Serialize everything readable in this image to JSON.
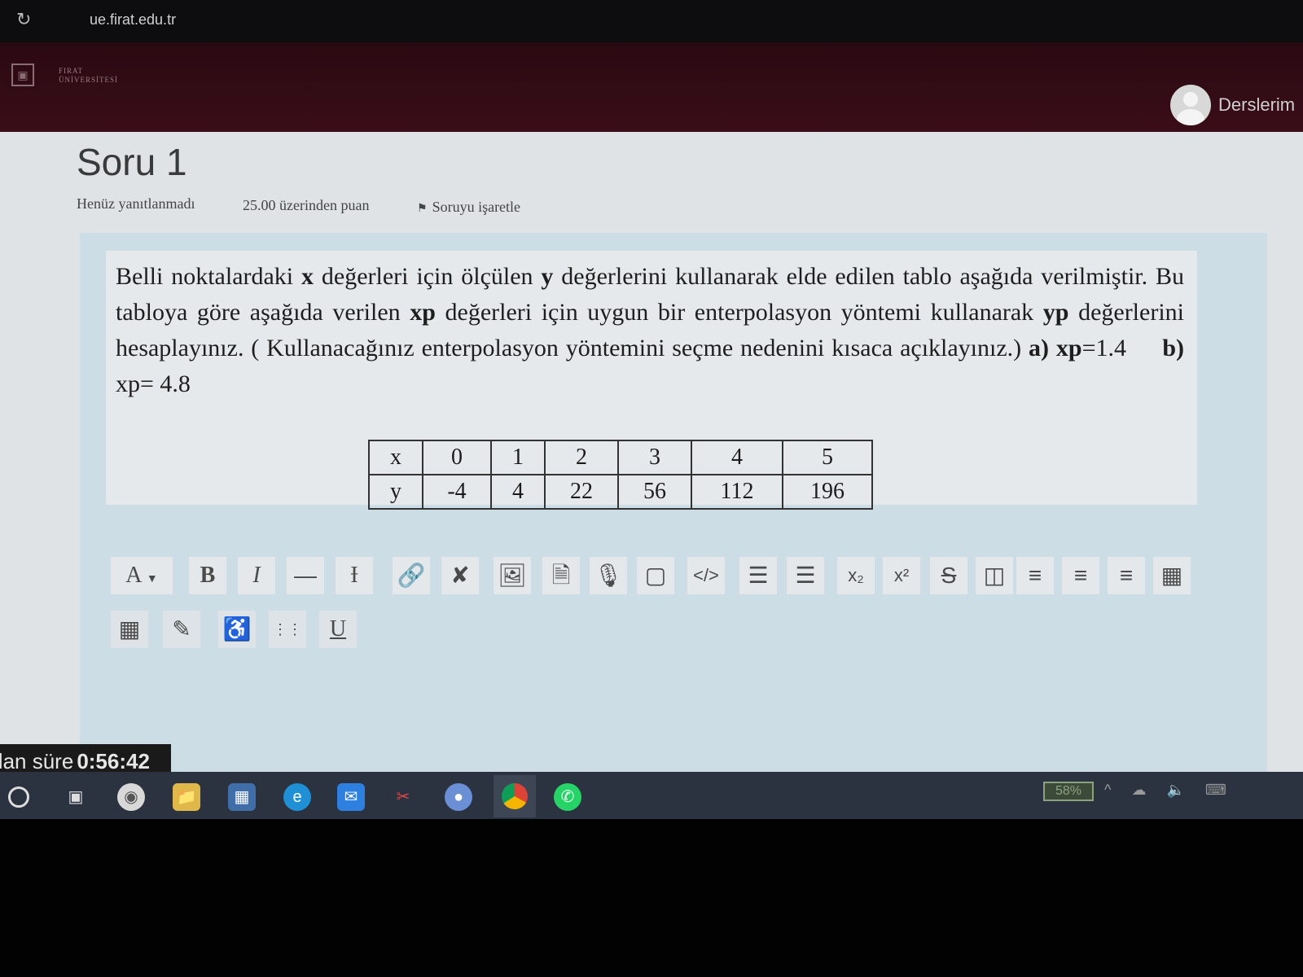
{
  "browser": {
    "url": "ue.firat.edu.tr"
  },
  "header": {
    "logo_line1": "FIRAT",
    "logo_line2": "ÜNİVERSİTESİ",
    "user_menu_label": "Derslerim"
  },
  "question": {
    "title": "Soru 1",
    "status": "Henüz yanıtlanmadı",
    "points": "25.00 üzerinden puan",
    "flag_label": "Soruyu işaretle",
    "text_part1": "Belli noktalardaki",
    "var_x": "x",
    "text_part2": "değerleri için ölçülen",
    "var_y": "y",
    "text_part3": "değerlerini kullanarak elde edilen tablo aşağıda verilmiştir. Bu tabloya göre aşağıda verilen",
    "var_xp": "xp",
    "text_part4": "değerleri için uygun bir enterpolasyon yöntemi kullanarak",
    "var_yp": "yp",
    "text_part5": "değerlerini hesaplayınız. ( Kullanacağınız enterpolasyon yöntemini seçme nedenini kısaca açıklayınız.)",
    "part_a_label": "a)",
    "part_a_var": "xp",
    "part_a_value": "=1.4",
    "part_b_label": "b)",
    "part_b_var": "xp",
    "part_b_value": "= 4.8"
  },
  "table": {
    "row_x": [
      "x",
      "0",
      "1",
      "2",
      "3",
      "4",
      "5"
    ],
    "row_y": [
      "y",
      "-4",
      "4",
      "22",
      "56",
      "112",
      "196"
    ]
  },
  "toolbar": {
    "font_label": "A",
    "bold_label": "B",
    "italic_label": "I",
    "underline_label": "U",
    "subscript_label": "x₂",
    "superscript_label": "x²"
  },
  "timer": {
    "label": "Kalan süre",
    "value": "0:56:42"
  },
  "taskbar": {
    "battery": "58%"
  }
}
